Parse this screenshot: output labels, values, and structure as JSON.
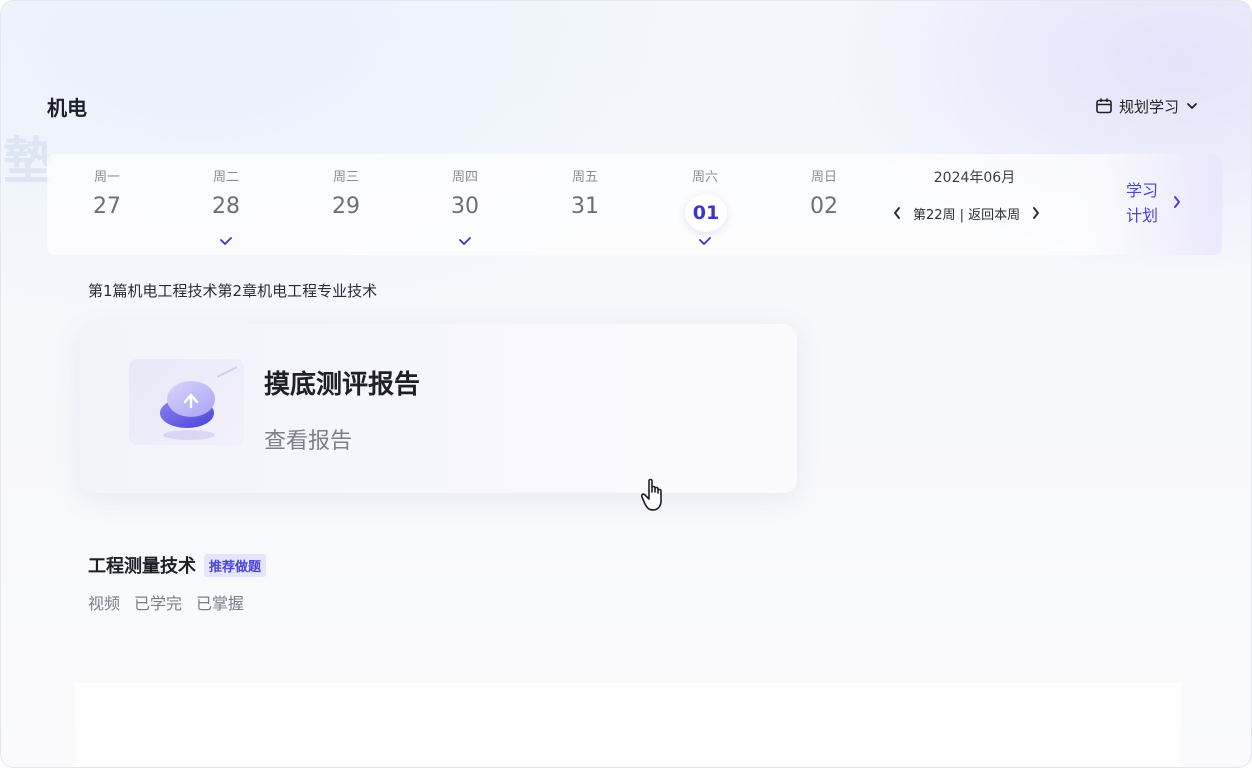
{
  "header": {
    "subject_title": "机电",
    "plan_button_label": "规划学习"
  },
  "watermark": "墊",
  "week": {
    "days": [
      {
        "name": "周一",
        "date": "27",
        "checked": false,
        "selected": false
      },
      {
        "name": "周二",
        "date": "28",
        "checked": true,
        "selected": false
      },
      {
        "name": "周三",
        "date": "29",
        "checked": false,
        "selected": false
      },
      {
        "name": "周四",
        "date": "30",
        "checked": true,
        "selected": false
      },
      {
        "name": "周五",
        "date": "31",
        "checked": false,
        "selected": false
      },
      {
        "name": "周六",
        "date": "01",
        "checked": true,
        "selected": true
      },
      {
        "name": "周日",
        "date": "02",
        "checked": false,
        "selected": false
      }
    ],
    "month_label": "2024年06月",
    "week_label": "第22周 | 返回本周",
    "study_plan_label": "学习计划"
  },
  "chapter_title": "第1篇机电工程技术第2章机电工程专业技术",
  "report_card": {
    "title": "摸底测评报告",
    "link_label": "查看报告"
  },
  "topic": {
    "title": "工程测量技术",
    "badge": "推荐做题",
    "stats": [
      "视频",
      "已学完",
      "已掌握"
    ]
  },
  "colors": {
    "accent": "#4a45d6",
    "selected_date": "#3b35c9",
    "badge_bg": "#e6e4fb"
  }
}
